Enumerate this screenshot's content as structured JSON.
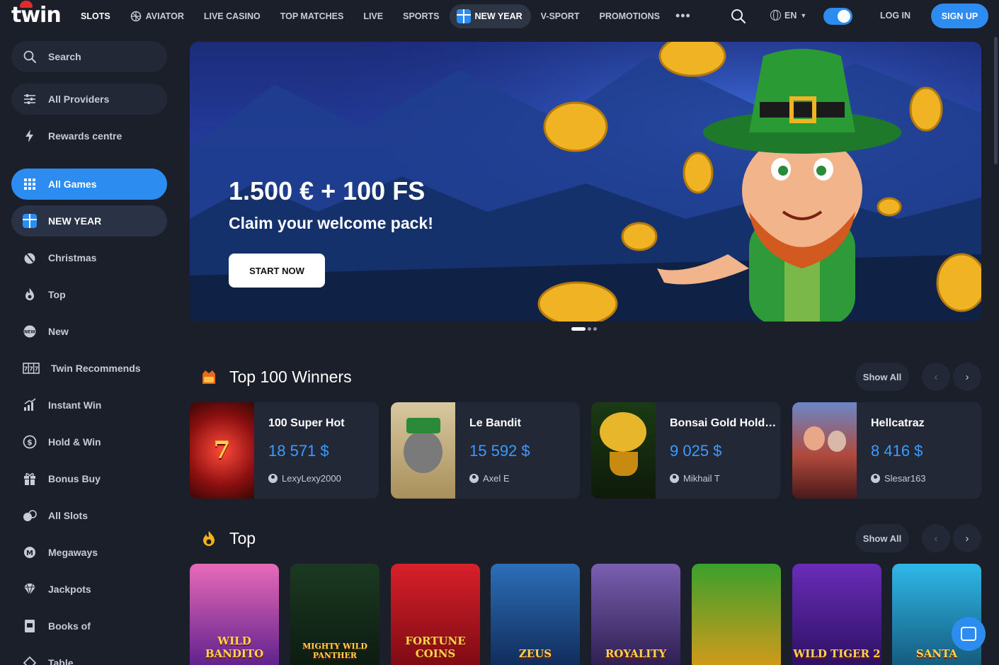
{
  "logo": {
    "text": "twin"
  },
  "nav": {
    "items": [
      {
        "label": "SLOTS",
        "icon": ""
      },
      {
        "label": "AVIATOR",
        "icon": "aviator-icon"
      },
      {
        "label": "LIVE CASINO",
        "icon": ""
      },
      {
        "label": "TOP MATCHES",
        "icon": ""
      },
      {
        "label": "LIVE",
        "icon": ""
      },
      {
        "label": "SPORTS",
        "icon": ""
      },
      {
        "label": "NEW YEAR",
        "icon": "gift-icon"
      },
      {
        "label": "V-SPORT",
        "icon": ""
      },
      {
        "label": "PROMOTIONS",
        "icon": ""
      }
    ],
    "more": "•••",
    "language": "EN",
    "login": "LOG IN",
    "signup": "SIGN UP"
  },
  "sidebar": {
    "search": "Search",
    "providers": "All Providers",
    "rewards": "Rewards centre",
    "items": [
      {
        "label": "All Games",
        "icon": "grid-icon"
      },
      {
        "label": "NEW YEAR",
        "icon": "gift-icon"
      },
      {
        "label": "Christmas",
        "icon": "christmas-icon"
      },
      {
        "label": "Top",
        "icon": "flame-icon"
      },
      {
        "label": "New",
        "icon": "new-badge-icon"
      },
      {
        "label": "Twin Recommends",
        "icon": "slot-reels-icon"
      },
      {
        "label": "Instant Win",
        "icon": "bar-chart-icon"
      },
      {
        "label": "Hold & Win",
        "icon": "coin-icon"
      },
      {
        "label": "Bonus Buy",
        "icon": "gift-box-icon"
      },
      {
        "label": "All Slots",
        "icon": "slots-icon"
      },
      {
        "label": "Megaways",
        "icon": "megaways-icon"
      },
      {
        "label": "Jackpots",
        "icon": "diamond-icon"
      },
      {
        "label": "Books of",
        "icon": "book-icon"
      },
      {
        "label": "Table",
        "icon": "table-icon"
      }
    ]
  },
  "banner": {
    "title": "1.500 € + 100 FS",
    "subtitle": "Claim your welcome pack!",
    "button": "START NOW"
  },
  "winners": {
    "title": "Top 100 Winners",
    "show_all": "Show All",
    "cards": [
      {
        "game": "100 Super Hot",
        "amount": "18 571 $",
        "user": "LexyLexy2000",
        "thumb_color": "#8c1010"
      },
      {
        "game": "Le Bandit",
        "amount": "15 592 $",
        "user": "Axel E",
        "thumb_color": "#c6b48a"
      },
      {
        "game": "Bonsai Gold Hold…",
        "amount": "9 025 $",
        "user": "Mikhail T",
        "thumb_color": "#2f5a1c"
      },
      {
        "game": "Hellcatraz",
        "amount": "8 416 $",
        "user": "Slesar163",
        "thumb_color": "#b04a3c"
      }
    ]
  },
  "top": {
    "title": "Top",
    "show_all": "Show All",
    "tiles": [
      {
        "name": "WILD BANDITO",
        "c1": "#e86ab8",
        "c2": "#5a1f8c"
      },
      {
        "name": "MIGHTY WILD PANTHER",
        "c1": "#1b3a22",
        "c2": "#0c1a10"
      },
      {
        "name": "FORTUNE COINS",
        "c1": "#d8202a",
        "c2": "#7a0a12"
      },
      {
        "name": "ZEUS",
        "c1": "#2c6fb8",
        "c2": "#102a58"
      },
      {
        "name": "ROYALITY",
        "c1": "#7a5fb0",
        "c2": "#2b1d4d"
      },
      {
        "name": "",
        "c1": "#3aa02c",
        "c2": "#d69a1a"
      },
      {
        "name": "WILD TIGER 2",
        "c1": "#6a2cb8",
        "c2": "#2a1060"
      },
      {
        "name": "SANTA",
        "c1": "#2fb8e8",
        "c2": "#14587a"
      }
    ]
  },
  "colors": {
    "accent": "#2d8cf0",
    "bg": "#1a1f29",
    "card": "#222836",
    "amount": "#3d9bff"
  }
}
